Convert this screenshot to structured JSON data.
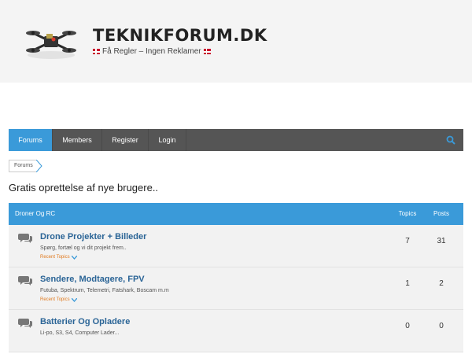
{
  "site": {
    "title": "TEKNIKFORUM.DK",
    "tagline": "Få Regler – Ingen Reklamer"
  },
  "nav": {
    "items": [
      "Forums",
      "Members",
      "Register",
      "Login"
    ],
    "active_index": 0,
    "search_icon": "search-icon"
  },
  "breadcrumb": [
    "Forums"
  ],
  "page_title": "Gratis oprettelse af nye brugere..",
  "forum_table": {
    "category": "Droner Og RC",
    "topics_header": "Topics",
    "posts_header": "Posts",
    "rows": [
      {
        "name": "Drone Projekter + Billeder",
        "description": "Spørg, fortæl og vi dit projekt frem..",
        "recent": "Recent Topics",
        "topics": "7",
        "posts": "31"
      },
      {
        "name": "Sendere, Modtagere, FPV",
        "description": "Futuba, Spektrum, Telemetri, Fatshark, Boscam m.m",
        "recent": "Recent Topics",
        "topics": "1",
        "posts": "2"
      },
      {
        "name": "Batterier Og Opladere",
        "description": "Li-po, S3, S4, Computer Lader...",
        "topics": "0",
        "posts": "0"
      }
    ]
  },
  "colors": {
    "accent": "#3a9ad9",
    "nav_bg": "#555555",
    "link": "#2a6496",
    "recent": "#e07a1f"
  }
}
